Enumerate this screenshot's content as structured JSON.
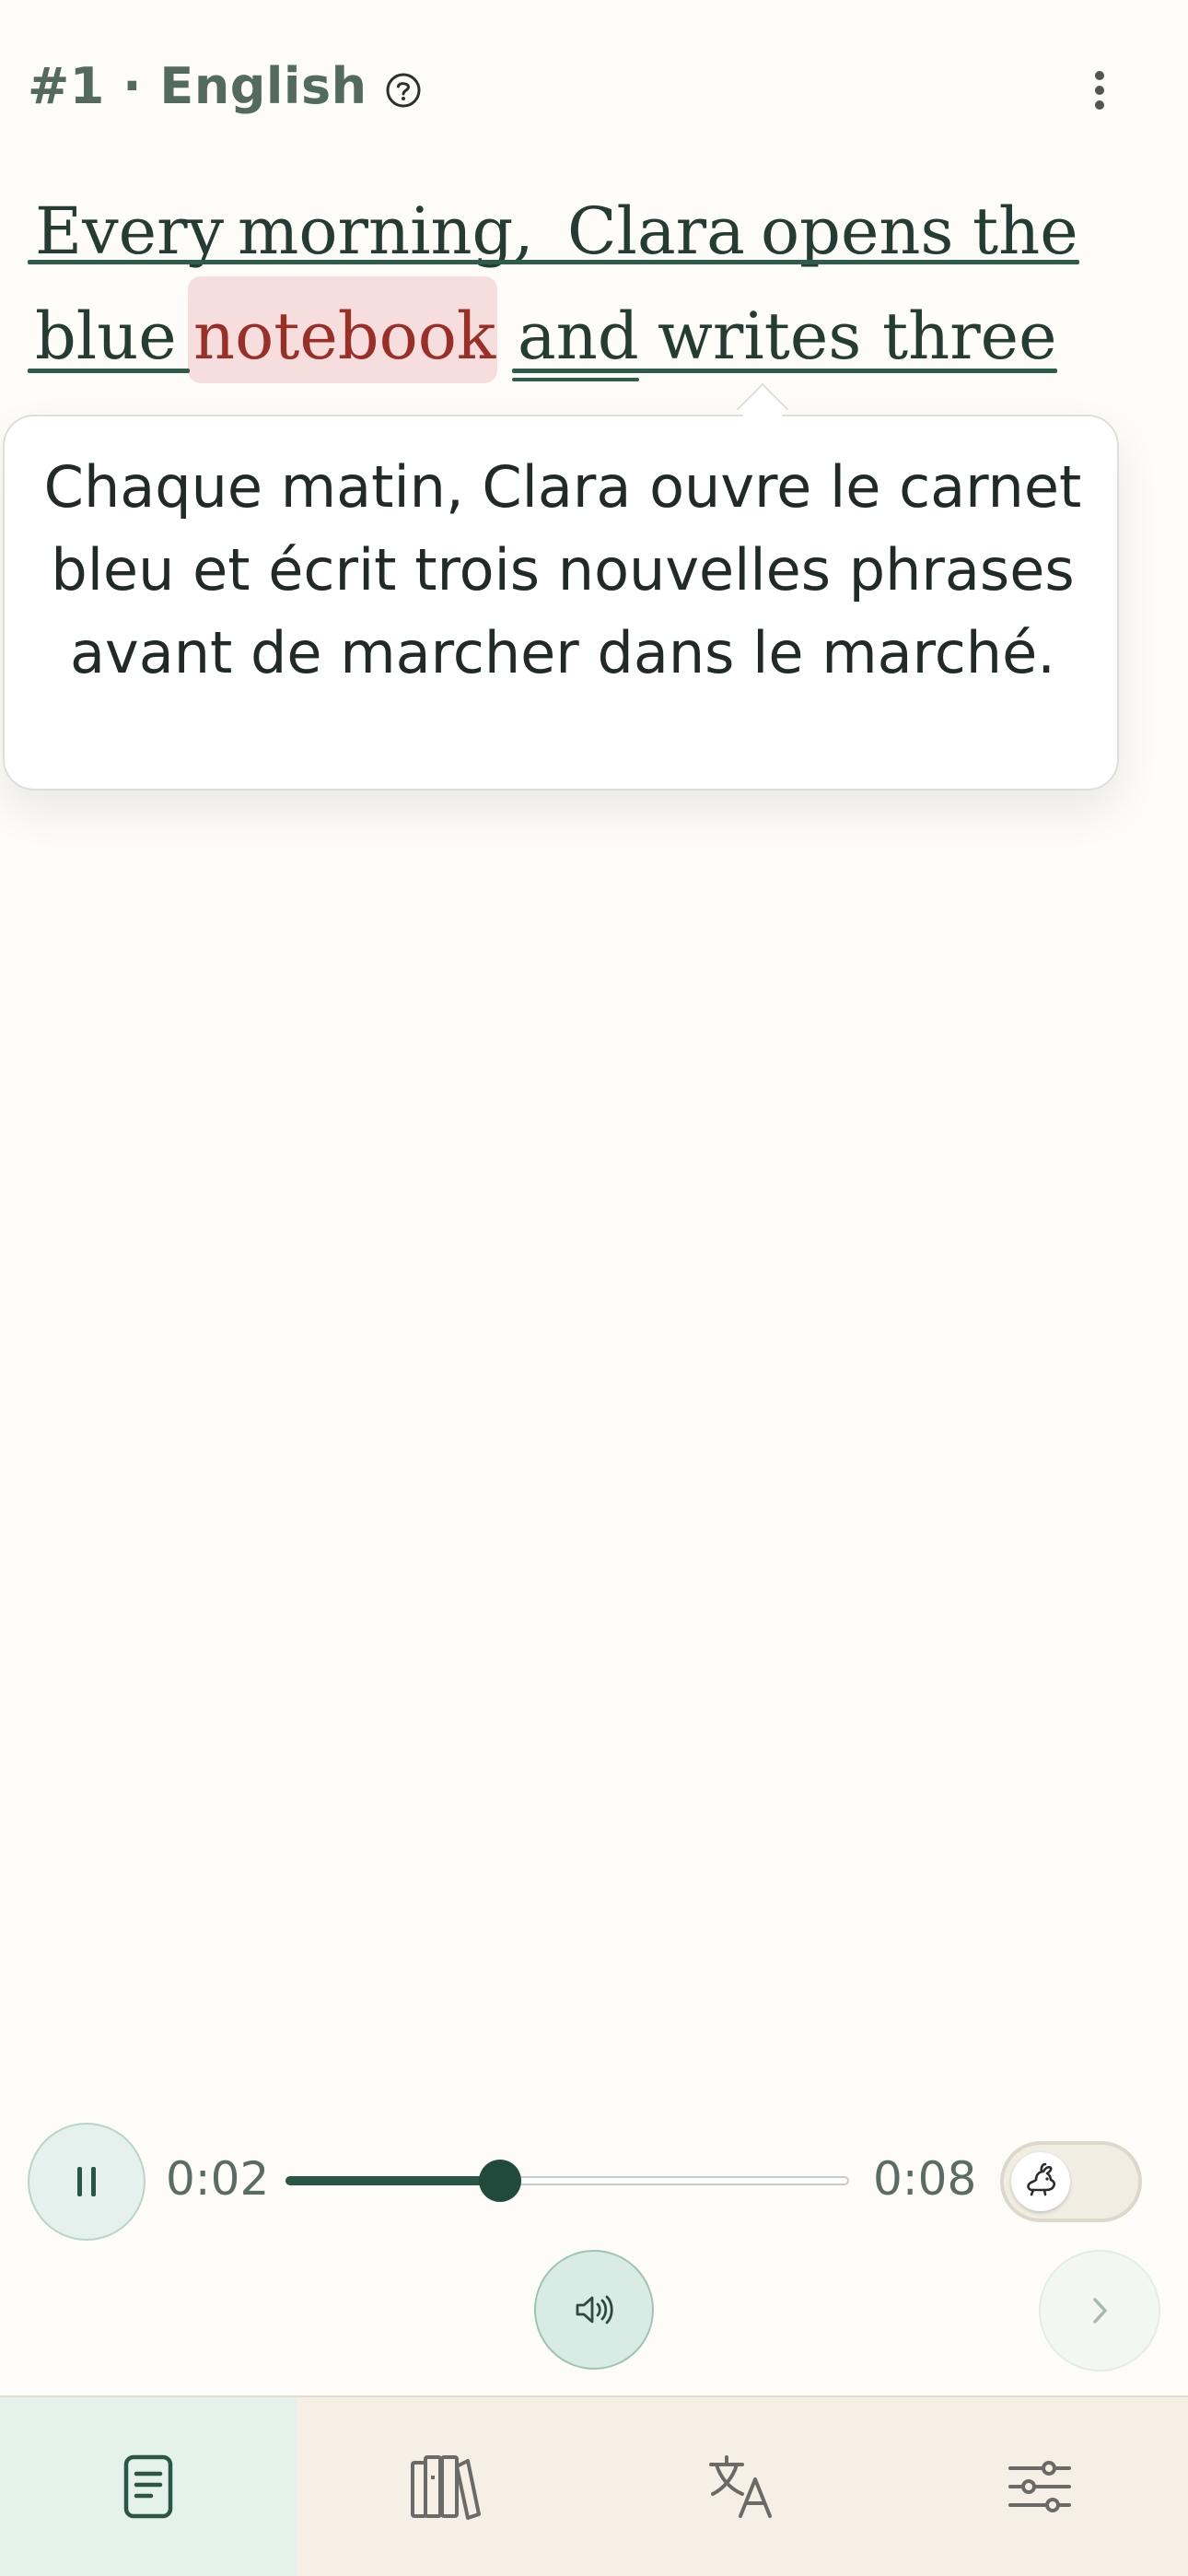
{
  "header": {
    "title": "#1 · English",
    "help_icon": "question-circle-icon",
    "menu_icon": "more-vertical-icon"
  },
  "reading": {
    "line1_words": [
      "Every",
      "morning,",
      "Clara",
      "opens",
      "the"
    ],
    "line2_words": [
      "blue",
      "notebook",
      "and",
      "writes",
      "three"
    ],
    "highlighted_word": "notebook"
  },
  "translation": {
    "text": "Chaque matin, Clara ouvre le carnet bleu et écrit trois nouvelles phrases avant de marcher dans le marché."
  },
  "player": {
    "state_icon": "pause-icon",
    "current_time": "0:02",
    "total_time": "0:08",
    "progress": 0.38,
    "speed_icon": "rabbit-icon",
    "audio_icon": "speaker-icon",
    "next_icon": "chevron-right-icon"
  },
  "nav": {
    "items": [
      {
        "icon": "document-icon",
        "active": true
      },
      {
        "icon": "library-icon",
        "active": false
      },
      {
        "icon": "translate-icon",
        "active": false
      },
      {
        "icon": "sliders-icon",
        "active": false
      }
    ]
  },
  "colors": {
    "accent": "#2a5647",
    "highlight_bg": "#f7dede",
    "highlight_text": "#9a2f28",
    "background": "#fdfcf9",
    "nav_bg": "#f6efe6"
  }
}
